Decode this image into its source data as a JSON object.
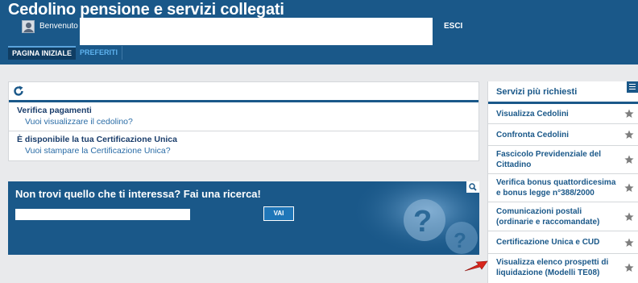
{
  "header": {
    "title": "Cedolino pensione e servizi collegati",
    "welcome": "Benvenuto",
    "logout": "ESCI",
    "tabs": [
      {
        "label": "PAGINA INIZIALE",
        "active": true
      },
      {
        "label": "PREFERITI",
        "active": false
      }
    ]
  },
  "notifications": {
    "items": [
      {
        "title": "Verifica pagamenti",
        "link": "Vuoi visualizzare il cedolino?"
      },
      {
        "title": "È disponibile la tua Certificazione Unica",
        "link": "Vuoi stampare la Certificazione Unica?"
      }
    ]
  },
  "search": {
    "title": "Non trovi quello che ti interessa? Fai una ricerca!",
    "value": "",
    "button": "VAI"
  },
  "services": {
    "title": "Servizi più richiesti",
    "items": [
      {
        "label": "Visualizza Cedolini"
      },
      {
        "label": "Confronta Cedolini"
      },
      {
        "label": "Fascicolo Previdenziale del Cittadino"
      },
      {
        "label": "Verifica bonus quattordicesima e bonus legge n°388/2000"
      },
      {
        "label": "Comunicazioni postali (ordinarie e raccomandate)"
      },
      {
        "label": "Certificazione Unica e CUD"
      },
      {
        "label": "Visualizza elenco prospetti di liquidazione (Modelli TE08)"
      }
    ]
  },
  "colors": {
    "primary": "#1a5889",
    "accent_link": "#5fb3f0",
    "highlight_arrow": "#d8261c"
  }
}
